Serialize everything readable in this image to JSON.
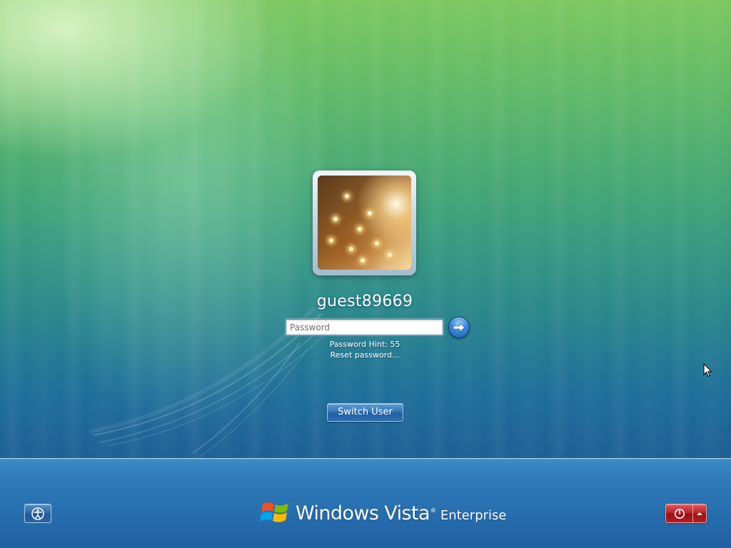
{
  "user": {
    "name": "guest89669"
  },
  "login": {
    "password_placeholder": "Password",
    "password_value": "",
    "hint": "Password Hint: 55",
    "reset_link": "Reset password..."
  },
  "switch_user": {
    "label": "Switch User"
  },
  "brand": {
    "name": "Windows Vista",
    "trademark": "®",
    "edition": "Enterprise"
  },
  "icons": {
    "submit": "arrow-right-icon",
    "ease_of_access": "ease-of-access-icon",
    "power": "power-icon",
    "power_options": "up-arrow-icon",
    "logo": "windows-flag-icon",
    "pointer": "mouse-cursor-icon"
  },
  "colors": {
    "shutdown_red": "#b52126",
    "accent_blue": "#2f73b4"
  }
}
